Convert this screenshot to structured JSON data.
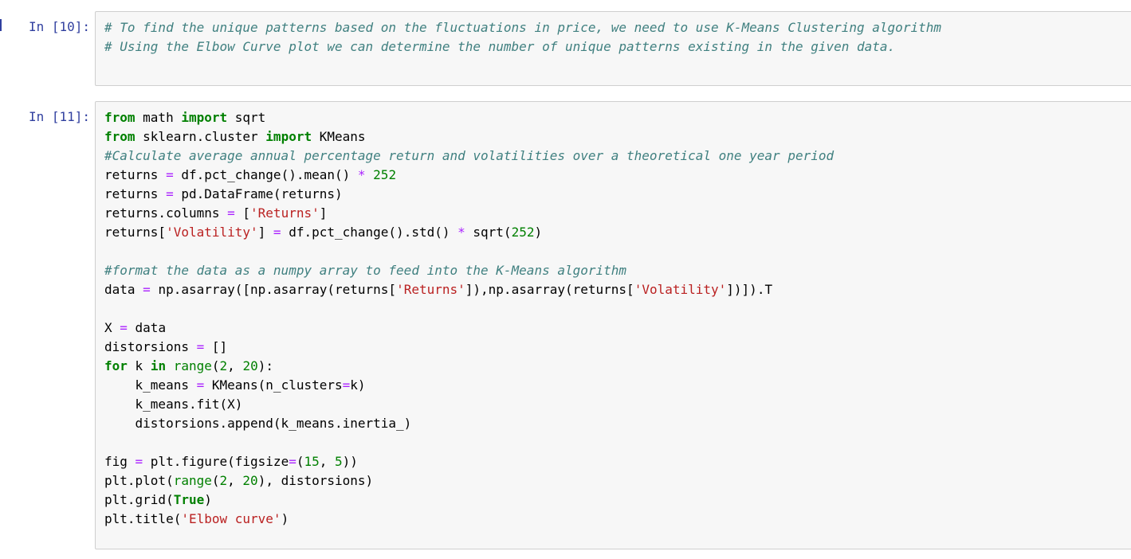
{
  "cells": [
    {
      "prompt": "In [10]:",
      "lines": [
        [
          {
            "t": "# To find the unique patterns based on the fluctuations in price, we need to use K-Means Clustering algorithm",
            "c": "com"
          }
        ],
        [
          {
            "t": "# Using the Elbow Curve plot we can determine the number of unique patterns existing in the given data.",
            "c": "com"
          }
        ]
      ]
    },
    {
      "prompt": "In [11]:",
      "lines": [
        [
          {
            "t": "from",
            "c": "kw"
          },
          {
            "t": " math ",
            "c": ""
          },
          {
            "t": "import",
            "c": "kw"
          },
          {
            "t": " sqrt",
            "c": ""
          }
        ],
        [
          {
            "t": "from",
            "c": "kw"
          },
          {
            "t": " sklearn.cluster ",
            "c": ""
          },
          {
            "t": "import",
            "c": "kw"
          },
          {
            "t": " KMeans",
            "c": ""
          }
        ],
        [
          {
            "t": "#Calculate average annual percentage return and volatilities over a theoretical one year period",
            "c": "com"
          }
        ],
        [
          {
            "t": "returns ",
            "c": ""
          },
          {
            "t": "=",
            "c": "op"
          },
          {
            "t": " df.pct_change().mean() ",
            "c": ""
          },
          {
            "t": "*",
            "c": "op"
          },
          {
            "t": " ",
            "c": ""
          },
          {
            "t": "252",
            "c": "num"
          }
        ],
        [
          {
            "t": "returns ",
            "c": ""
          },
          {
            "t": "=",
            "c": "op"
          },
          {
            "t": " pd.DataFrame(returns)",
            "c": ""
          }
        ],
        [
          {
            "t": "returns.columns ",
            "c": ""
          },
          {
            "t": "=",
            "c": "op"
          },
          {
            "t": " [",
            "c": ""
          },
          {
            "t": "'Returns'",
            "c": "str"
          },
          {
            "t": "]",
            "c": ""
          }
        ],
        [
          {
            "t": "returns[",
            "c": ""
          },
          {
            "t": "'Volatility'",
            "c": "str"
          },
          {
            "t": "] ",
            "c": ""
          },
          {
            "t": "=",
            "c": "op"
          },
          {
            "t": " df.pct_change().std() ",
            "c": ""
          },
          {
            "t": "*",
            "c": "op"
          },
          {
            "t": " sqrt(",
            "c": ""
          },
          {
            "t": "252",
            "c": "num"
          },
          {
            "t": ")",
            "c": ""
          }
        ],
        [],
        [
          {
            "t": "#format the data as a numpy array to feed into the K-Means algorithm",
            "c": "com"
          }
        ],
        [
          {
            "t": "data ",
            "c": ""
          },
          {
            "t": "=",
            "c": "op"
          },
          {
            "t": " np.asarray([np.asarray(returns[",
            "c": ""
          },
          {
            "t": "'Returns'",
            "c": "str"
          },
          {
            "t": "]),np.asarray(returns[",
            "c": ""
          },
          {
            "t": "'Volatility'",
            "c": "str"
          },
          {
            "t": "])]).T",
            "c": ""
          }
        ],
        [],
        [
          {
            "t": "X ",
            "c": ""
          },
          {
            "t": "=",
            "c": "op"
          },
          {
            "t": " data",
            "c": ""
          }
        ],
        [
          {
            "t": "distorsions ",
            "c": ""
          },
          {
            "t": "=",
            "c": "op"
          },
          {
            "t": " []",
            "c": ""
          }
        ],
        [
          {
            "t": "for",
            "c": "kw"
          },
          {
            "t": " k ",
            "c": ""
          },
          {
            "t": "in",
            "c": "kw"
          },
          {
            "t": " ",
            "c": ""
          },
          {
            "t": "range",
            "c": "bi"
          },
          {
            "t": "(",
            "c": ""
          },
          {
            "t": "2",
            "c": "num"
          },
          {
            "t": ", ",
            "c": ""
          },
          {
            "t": "20",
            "c": "num"
          },
          {
            "t": "):",
            "c": ""
          }
        ],
        [
          {
            "t": "    k_means ",
            "c": ""
          },
          {
            "t": "=",
            "c": "op"
          },
          {
            "t": " KMeans(n_clusters",
            "c": ""
          },
          {
            "t": "=",
            "c": "op"
          },
          {
            "t": "k)",
            "c": ""
          }
        ],
        [
          {
            "t": "    k_means.fit(X)",
            "c": ""
          }
        ],
        [
          {
            "t": "    distorsions.append(k_means.inertia_)",
            "c": ""
          }
        ],
        [],
        [
          {
            "t": "fig ",
            "c": ""
          },
          {
            "t": "=",
            "c": "op"
          },
          {
            "t": " plt.figure(figsize",
            "c": ""
          },
          {
            "t": "=",
            "c": "op"
          },
          {
            "t": "(",
            "c": ""
          },
          {
            "t": "15",
            "c": "num"
          },
          {
            "t": ", ",
            "c": ""
          },
          {
            "t": "5",
            "c": "num"
          },
          {
            "t": "))",
            "c": ""
          }
        ],
        [
          {
            "t": "plt.plot(",
            "c": ""
          },
          {
            "t": "range",
            "c": "bi"
          },
          {
            "t": "(",
            "c": ""
          },
          {
            "t": "2",
            "c": "num"
          },
          {
            "t": ", ",
            "c": ""
          },
          {
            "t": "20",
            "c": "num"
          },
          {
            "t": "), distorsions)",
            "c": ""
          }
        ],
        [
          {
            "t": "plt.grid(",
            "c": ""
          },
          {
            "t": "True",
            "c": "kw"
          },
          {
            "t": ")",
            "c": ""
          }
        ],
        [
          {
            "t": "plt.title(",
            "c": ""
          },
          {
            "t": "'Elbow curve'",
            "c": "str"
          },
          {
            "t": ")",
            "c": ""
          }
        ]
      ]
    }
  ]
}
